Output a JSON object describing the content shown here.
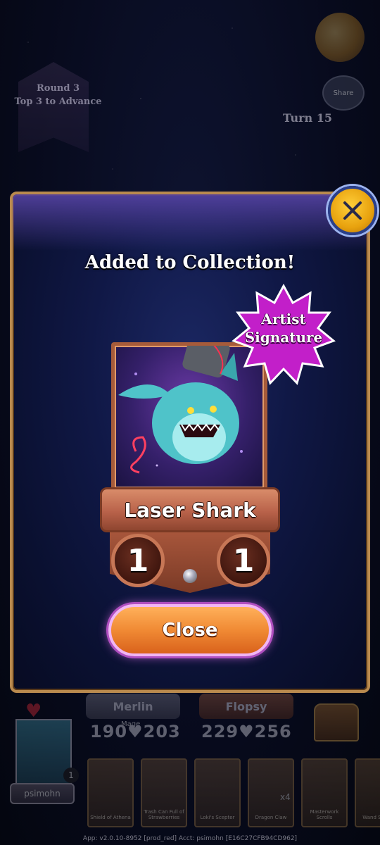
{
  "hud": {
    "round_line1": "Round 3",
    "round_line2": "Top 3 to Advance",
    "share_label": "Share",
    "turn_label": "Turn 15"
  },
  "opponents": [
    {
      "name": "Merlin",
      "attack": "190",
      "health": "203",
      "class_tag": "Mage"
    },
    {
      "name": "Flopsy",
      "attack": "229",
      "health": "256"
    }
  ],
  "player": {
    "name": "psimohn",
    "level": "1"
  },
  "hand_cards": [
    {
      "label": "Shield of Athena"
    },
    {
      "label": "Trash Can Full of Strawberries"
    },
    {
      "label": "Loki's Scepter"
    },
    {
      "label": "Dragon Claw",
      "count": "x4"
    },
    {
      "label": "Masterwork Scrolls"
    },
    {
      "label": "Wand Shield"
    }
  ],
  "footer": "App: v2.0.10-8952 [prod_red] Acct: psimohn [E16C27CFB94CD962]",
  "modal": {
    "title": "Added to Collection!",
    "badge_line1": "Artist",
    "badge_line2": "Signature",
    "card_name": "Laser Shark",
    "attack": "1",
    "health": "1",
    "close_label": "Close"
  },
  "colors": {
    "modal_border": "#b98a4e",
    "close_button": "#f08a34",
    "badge": "#c21fc9",
    "banner": "#b9624a"
  },
  "icons": [
    "coin-icon",
    "share-icon",
    "close-x-icon",
    "heart-icon",
    "chest-icon",
    "rarity-gem-icon"
  ]
}
